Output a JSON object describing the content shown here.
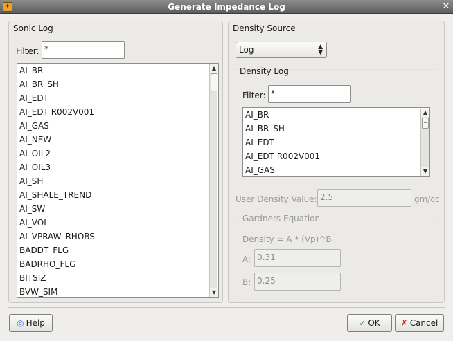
{
  "window": {
    "title": "Generate Impedance Log",
    "close_glyph": "✕",
    "app_icon": "app-icon"
  },
  "sonic": {
    "group_label": "Sonic Log",
    "filter_label": "Filter:",
    "filter_value": "*",
    "items": [
      "AI_BR",
      "AI_BR_SH",
      "AI_EDT",
      "AI_EDT R002V001",
      "AI_GAS",
      "AI_NEW",
      "AI_OIL2",
      "AI_OIL3",
      "AI_SH",
      "AI_SHALE_TREND",
      "AI_SW",
      "AI_VOL",
      "AI_VPRAW_RHOBS",
      "BADDT_FLG",
      "BADRHO_FLG",
      "BITSIZ",
      "BVW_SIM"
    ]
  },
  "density_source": {
    "group_label": "Density Source",
    "selected": "Log"
  },
  "density_log": {
    "group_label": "Density Log",
    "filter_label": "Filter:",
    "filter_value": "*",
    "items": [
      "AI_BR",
      "AI_BR_SH",
      "AI_EDT",
      "AI_EDT R002V001",
      "AI_GAS"
    ]
  },
  "user_density": {
    "label": "User Density Value:",
    "value": "2.5",
    "unit": "gm/cc"
  },
  "gardners": {
    "group_label": "Gardners Equation",
    "equation": "Density = A * (Vp)^B",
    "a_label": "A:",
    "a_value": "0.31",
    "b_label": "B:",
    "b_value": "0.25"
  },
  "buttons": {
    "help": "Help",
    "ok": "OK",
    "cancel": "Cancel"
  },
  "colors": {
    "ok_check": "#2e8b2e",
    "cancel_x": "#cc2222",
    "help_icon": "#3a7bd5"
  }
}
